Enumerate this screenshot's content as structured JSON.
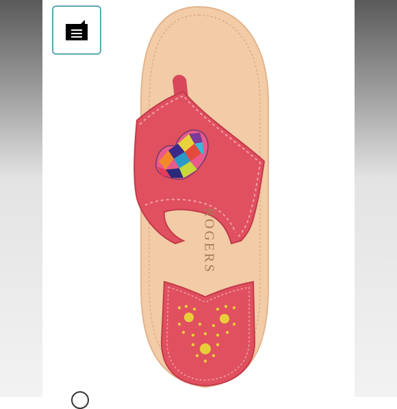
{
  "brand": {
    "imprint": "ROGERS"
  },
  "toolbar": {
    "share_button_icon": "share-list-icon"
  },
  "colors": {
    "accent_border": "#5aa8b3",
    "strap_pink": "#e0505f",
    "footbed_tan": "#f0c9a4",
    "stud_yellow": "#e8cf3a"
  }
}
